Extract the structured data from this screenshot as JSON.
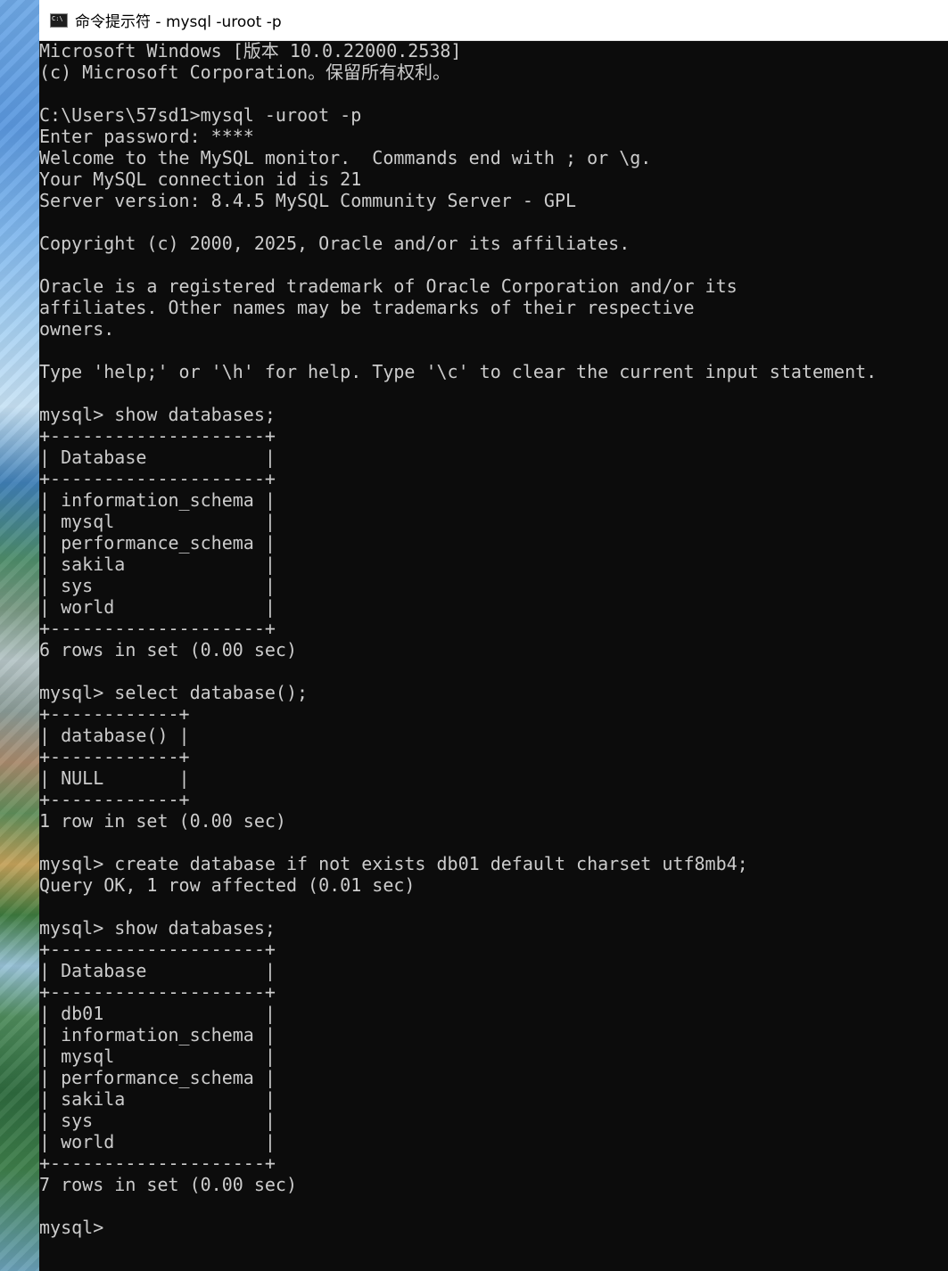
{
  "window": {
    "title": "命令提示符 - mysql  -uroot -p"
  },
  "icons": {
    "window_icon": "cmd-icon"
  },
  "colors": {
    "console_background": "#0c0c0c",
    "console_text": "#cccccc",
    "titlebar_background": "#ffffff"
  },
  "console": {
    "lines": [
      "Microsoft Windows [版本 10.0.22000.2538]",
      "(c) Microsoft Corporation。保留所有权利。",
      "",
      "C:\\Users\\57sd1>mysql -uroot -p",
      "Enter password: ****",
      "Welcome to the MySQL monitor.  Commands end with ; or \\g.",
      "Your MySQL connection id is 21",
      "Server version: 8.4.5 MySQL Community Server - GPL",
      "",
      "Copyright (c) 2000, 2025, Oracle and/or its affiliates.",
      "",
      "Oracle is a registered trademark of Oracle Corporation and/or its",
      "affiliates. Other names may be trademarks of their respective",
      "owners.",
      "",
      "Type 'help;' or '\\h' for help. Type '\\c' to clear the current input statement.",
      "",
      "mysql> show databases;",
      "+--------------------+",
      "| Database           |",
      "+--------------------+",
      "| information_schema |",
      "| mysql              |",
      "| performance_schema |",
      "| sakila             |",
      "| sys                |",
      "| world              |",
      "+--------------------+",
      "6 rows in set (0.00 sec)",
      "",
      "mysql> select database();",
      "+------------+",
      "| database() |",
      "+------------+",
      "| NULL       |",
      "+------------+",
      "1 row in set (0.00 sec)",
      "",
      "mysql> create database if not exists db01 default charset utf8mb4;",
      "Query OK, 1 row affected (0.01 sec)",
      "",
      "mysql> show databases;",
      "+--------------------+",
      "| Database           |",
      "+--------------------+",
      "| db01               |",
      "| information_schema |",
      "| mysql              |",
      "| performance_schema |",
      "| sakila             |",
      "| sys                |",
      "| world              |",
      "+--------------------+",
      "7 rows in set (0.00 sec)",
      "",
      "mysql>"
    ]
  }
}
